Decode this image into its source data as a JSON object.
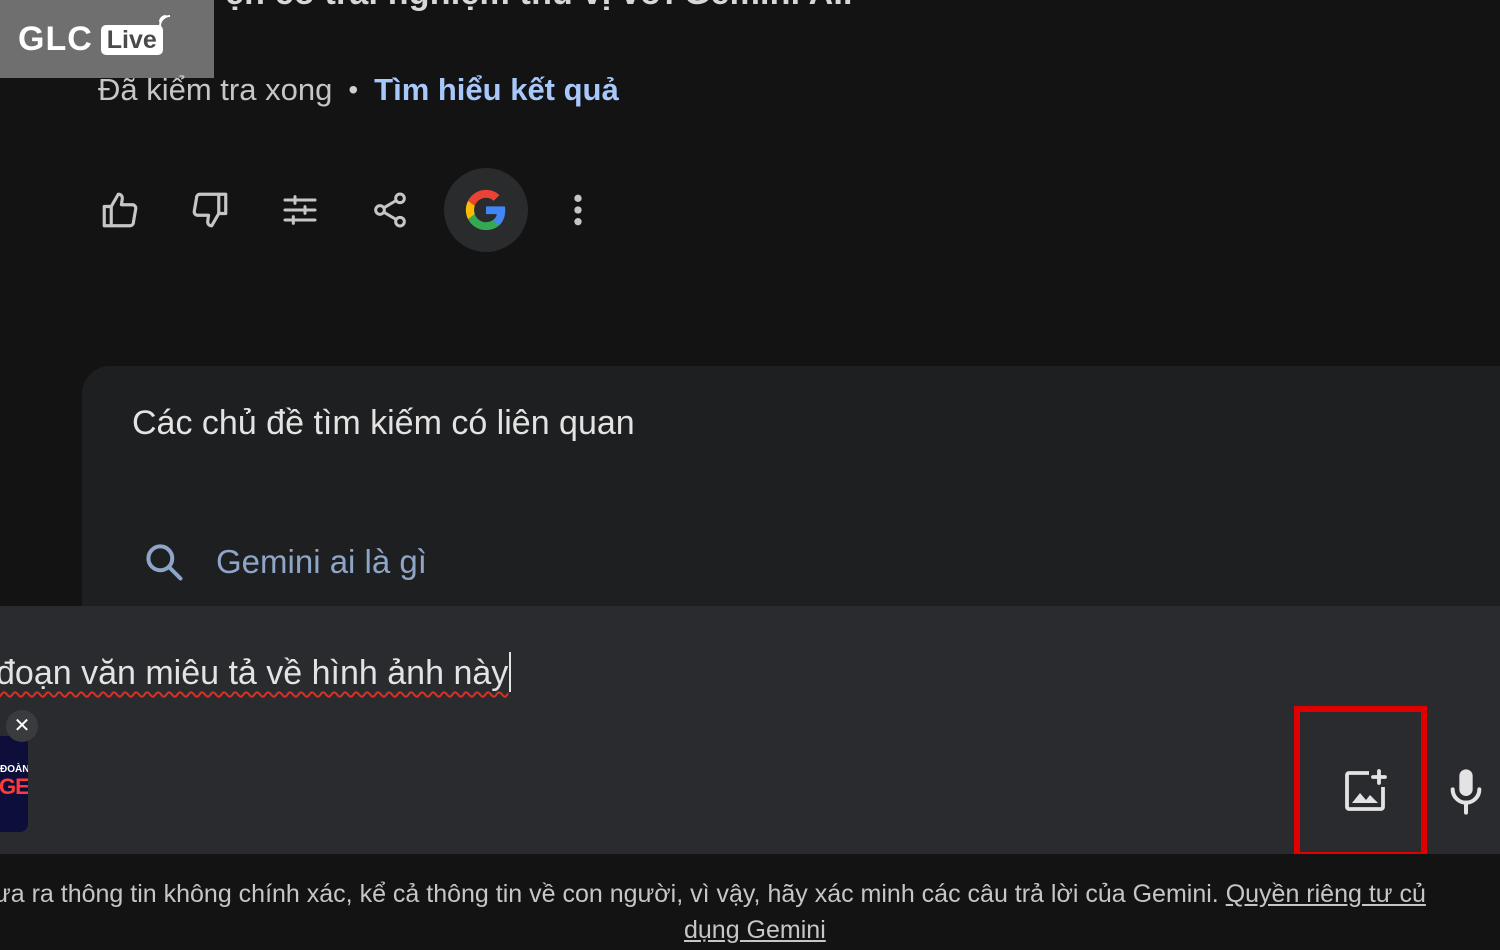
{
  "response": {
    "cut_heading": "ện có trải nghiệm thú vị với Gemini AI.",
    "status_text": "Đã kiểm tra xong",
    "status_separator": "•",
    "status_link": "Tìm hiểu kết quả"
  },
  "logo": {
    "text": "GLC",
    "badge": "Live"
  },
  "actions": [
    {
      "icon": "thumb-up-icon"
    },
    {
      "icon": "thumb-down-icon"
    },
    {
      "icon": "tune-icon"
    },
    {
      "icon": "share-icon"
    },
    {
      "icon": "google-icon"
    },
    {
      "icon": "more-vert-icon"
    }
  ],
  "related": {
    "title": "Các chủ đề tìm kiếm có liên quan",
    "items": [
      {
        "icon": "search-icon",
        "label": "Gemini ai là gì"
      }
    ]
  },
  "input": {
    "prompt_text": "đoạn văn miêu tả về hình ảnh này",
    "attachment": {
      "small_text": "ĐOÀN",
      "big_text": "GEN",
      "close_glyph": "✕"
    },
    "image_button_icon": "add-photo-icon",
    "mic_button_icon": "mic-icon"
  },
  "disclaimer": {
    "text": "ưa ra thông tin không chính xác, kể cả thông tin về con người, vì vậy, hãy xác minh các câu trả lời của Gemini.",
    "link1": "Quyền riêng tư củ",
    "link2": "dụng Gemini"
  },
  "colors": {
    "background": "#131314",
    "panel": "#1e1f20",
    "input_panel": "#2a2b2e",
    "link_blue": "#a8c7fa",
    "highlight_red": "#e00000"
  }
}
